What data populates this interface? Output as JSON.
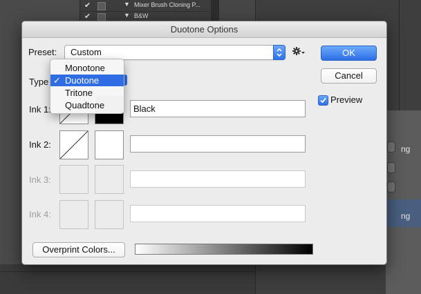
{
  "background": {
    "layers": [
      {
        "label": "Mixer Brush Cloning P..."
      },
      {
        "label": "B&W"
      }
    ],
    "right_panel_texts": [
      "ng",
      "ng"
    ]
  },
  "dialog": {
    "title": "Duotone Options",
    "preset_label": "Preset:",
    "preset_value": "Custom",
    "type_label": "Type",
    "type_menu": {
      "items": [
        {
          "label": "Monotone",
          "selected": false
        },
        {
          "label": "Duotone",
          "selected": true
        },
        {
          "label": "Tritone",
          "selected": false
        },
        {
          "label": "Quadtone",
          "selected": false
        }
      ]
    },
    "ok_label": "OK",
    "cancel_label": "Cancel",
    "preview_label": "Preview",
    "preview_checked": true,
    "inks": [
      {
        "label": "Ink 1:",
        "name": "Black",
        "enabled": true,
        "color": "#000000"
      },
      {
        "label": "Ink 2:",
        "name": "",
        "enabled": true,
        "color": "#ffffff"
      },
      {
        "label": "Ink 3:",
        "name": "",
        "enabled": false,
        "color": "#ececec"
      },
      {
        "label": "Ink 4:",
        "name": "",
        "enabled": false,
        "color": "#ececec"
      }
    ],
    "overprint_label": "Overprint Colors...",
    "accent_color": "#2e6de4"
  }
}
